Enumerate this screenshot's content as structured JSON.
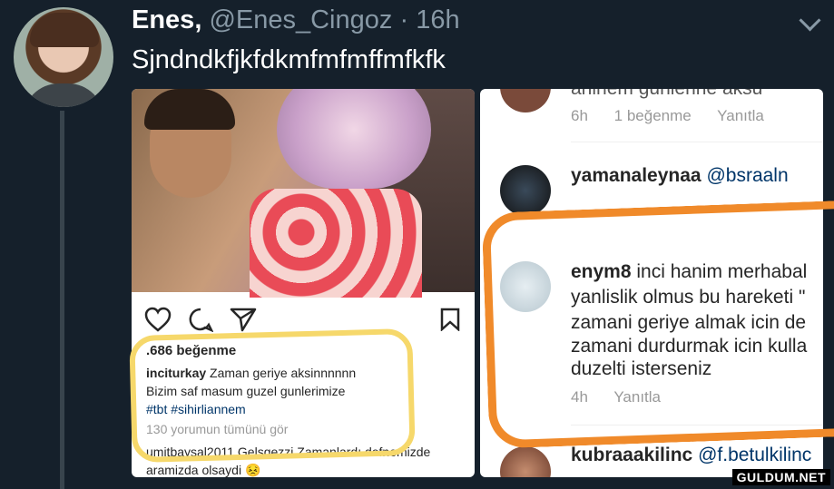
{
  "tweet": {
    "author_name": "Enes,",
    "author_handle": "@Enes_Cingoz",
    "separator": "·",
    "time": "16h",
    "text": "Sjndndkfjkfdkmfmfmffmfkfk"
  },
  "left_post": {
    "likes": ".686 beğenme",
    "caption_user": "inciturkay",
    "caption_text": "Zaman geriye aksinnnnnn",
    "caption_line2": "Bizim saf masum guzel gunlerimize",
    "hashtags": "#tbt #sihirliannem",
    "view_comments": "130 yorumun tümünü gör",
    "next_comment_line1": "umitbaysal2011 Gelsgezzi Zamanlardı defnemizde",
    "next_comment_line2": "aramizda olsaydi 😣",
    "icons": [
      "heart-icon",
      "comment-icon",
      "share-icon",
      "bookmark-icon"
    ]
  },
  "right_post": {
    "top_fragment": "anlnem gunlerine aksu",
    "top_meta": {
      "time": "6h",
      "likes": "1 beğenme",
      "reply": "Yanıtla"
    },
    "comment1": {
      "user": "yamanaleynaa",
      "mention": "@bsraaln"
    },
    "comment2": {
      "user": "enym8",
      "lines": [
        "inci hanim merhabal",
        "yanlislik olmus bu hareketi \"",
        "zamani geriye almak icin de",
        "zamani durdurmak icin kulla",
        "duzelti  isterseniz"
      ]
    },
    "comment2_meta": {
      "time": "4h",
      "reply": "Yanıtla"
    },
    "comment3": {
      "user": "kubraaakilinc",
      "mention": "@f.betulkilinc"
    }
  },
  "watermark": "GULDUM.NET",
  "colors": {
    "background": "#15202b",
    "highlight_yellow": "#f6d86b",
    "highlight_orange": "#f08a2a",
    "muted": "#8899a6"
  }
}
